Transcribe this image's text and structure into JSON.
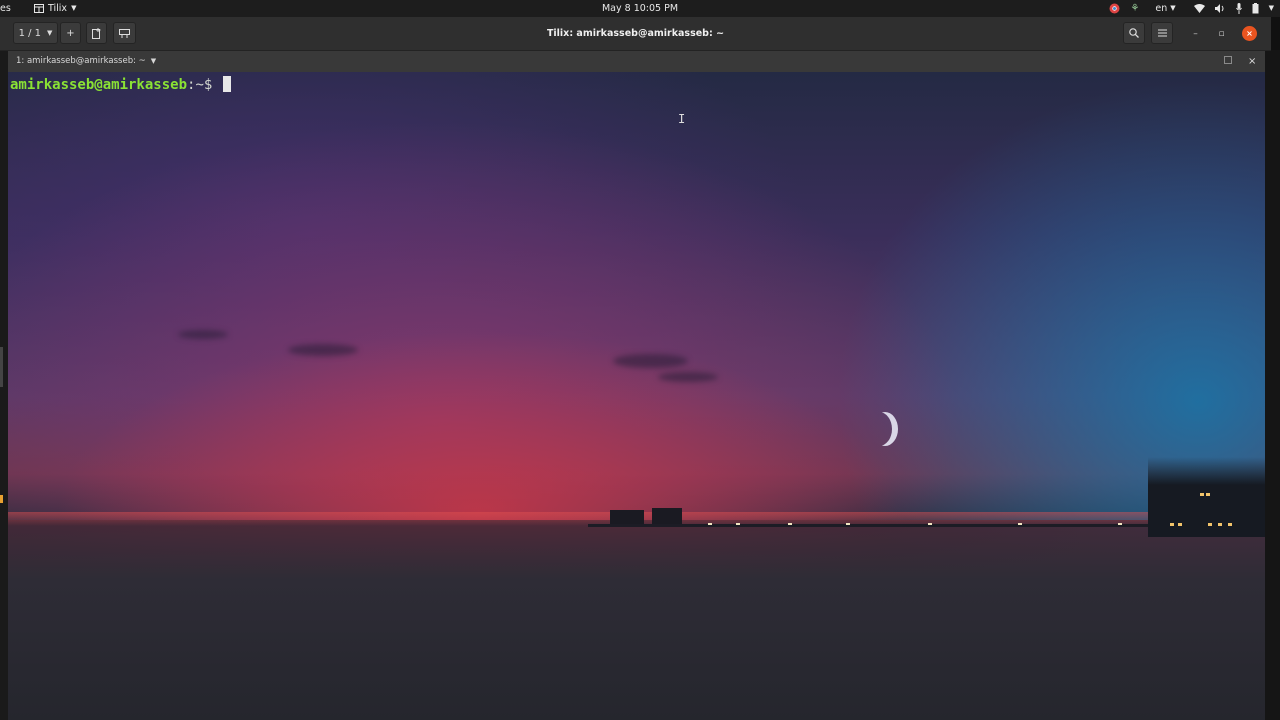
{
  "topbar": {
    "activities_label": "es",
    "app_name": "Tilix",
    "clock": "May 8  10:05 PM",
    "language": "en",
    "icons": [
      "app-grid-icon",
      "chrome-icon",
      "network-tray-icon",
      "wifi-icon",
      "volume-icon",
      "microphone-icon",
      "battery-icon",
      "system-menu-caret-icon"
    ]
  },
  "headerbar": {
    "session_counter": "1 / 1",
    "window_title": "Tilix: amirkasseb@amirkasseb: ~",
    "buttons": {
      "add": "+",
      "new_session_icon": "new-session-icon",
      "sync_icon": "sync-input-icon",
      "search_icon": "search-icon",
      "menu_icon": "hamburger-menu-icon"
    },
    "window_controls": {
      "minimize": "–",
      "maximize": "▫",
      "close": "×"
    }
  },
  "terminal": {
    "title": "1: amirkasseb@amirkasseb: ~",
    "close": "×",
    "prompt_user_host": "amirkasseb@amirkasseb",
    "prompt_colon": ":",
    "prompt_path": "~",
    "prompt_symbol": "$ ",
    "mouse_cursor": "I"
  },
  "colors": {
    "prompt_green": "#8ae234",
    "close_orange": "#e95420",
    "headerbar": "#2f2f2f",
    "topbar": "#1d1d1d"
  }
}
